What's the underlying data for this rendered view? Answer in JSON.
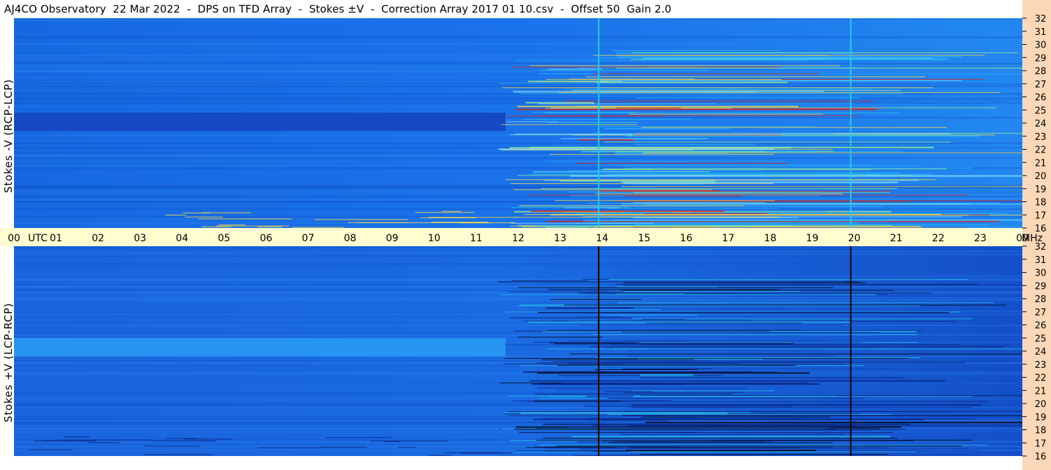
{
  "title": "AJ4CO Observatory  22 Mar 2022  -  DPS on TFD Array  -  Stokes ±V  -  Correction Array 2017 01 10.csv  -  Offset 50  Gain 2.0",
  "colors": {
    "base_blue": "#1a6ee6",
    "dark_band": "#1545c0",
    "cyan": "#28c8f0",
    "green": "#a0f090",
    "yellow": "#ffe040",
    "red": "#e02010",
    "black": "#000000",
    "axis_bg": "#fffcd0",
    "freq_strip_bg": "#fdd8b8"
  },
  "chart_data": [
    {
      "type": "heatmap",
      "name": "Stokes -V (RCP-LCP)",
      "ylabel": "Stokes -V  (RCP-LCP)",
      "x_axis": "UTC hours",
      "x_range": [
        0,
        24
      ],
      "y_axis": "MHz",
      "y_range": [
        16,
        32
      ],
      "y_ticks": [
        "32",
        "31",
        "30",
        "29",
        "28",
        "27",
        "26",
        "25",
        "24",
        "23",
        "22",
        "21",
        "20",
        "19",
        "18",
        "17",
        "16"
      ],
      "dark_band_mhz": [
        23.4,
        24.8
      ],
      "dark_band_hours": [
        0,
        11.7
      ],
      "active_hours": [
        12,
        24
      ],
      "vertical_lines_hours": [
        13.9,
        19.9
      ]
    },
    {
      "type": "heatmap",
      "name": "Stokes +V (LCP-RCP)",
      "ylabel": "Stokes +V  (LCP-RCP)",
      "x_axis": "UTC hours",
      "x_range": [
        0,
        24
      ],
      "y_axis": "MHz",
      "y_range": [
        16,
        32
      ],
      "y_ticks": [
        "32",
        "31",
        "30",
        "29",
        "28",
        "27",
        "26",
        "25",
        "24",
        "23",
        "22",
        "21",
        "20",
        "19",
        "18",
        "17",
        "16"
      ],
      "bright_band_mhz": [
        23.6,
        25.0
      ],
      "bright_band_hours": [
        0,
        11.7
      ],
      "active_hours": [
        12,
        24
      ],
      "vertical_lines_hours": [
        13.9,
        19.9
      ]
    }
  ],
  "time_axis": {
    "labels": [
      "00",
      "UTC",
      "01",
      "02",
      "03",
      "04",
      "05",
      "06",
      "07",
      "08",
      "09",
      "10",
      "11",
      "12",
      "13",
      "14",
      "15",
      "16",
      "17",
      "18",
      "19",
      "20",
      "21",
      "22",
      "23",
      "00",
      "MHz"
    ]
  }
}
